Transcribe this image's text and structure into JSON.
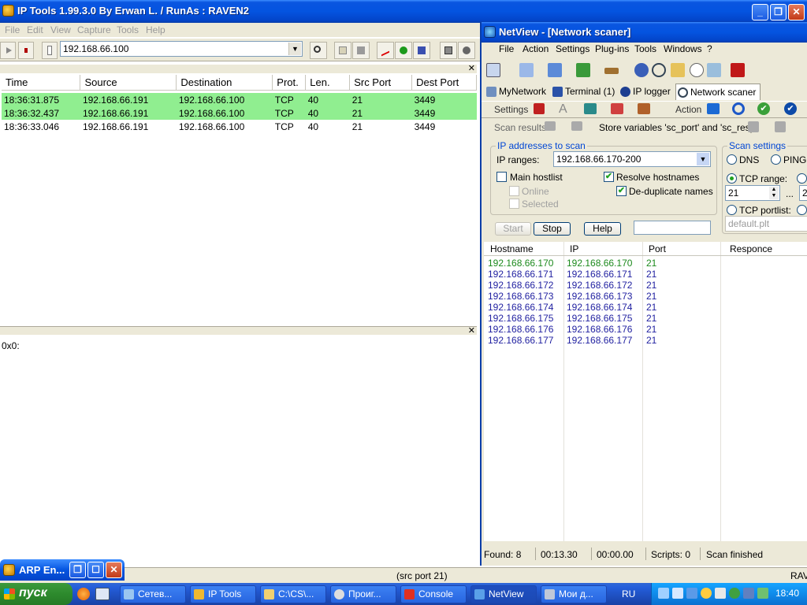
{
  "iptools": {
    "title": "IP Tools 1.99.3.0 By Erwan L. / RunAs : RAVEN2",
    "menu": [
      "File",
      "Edit",
      "View",
      "Capture",
      "Tools",
      "Help"
    ],
    "address": "192.168.66.100",
    "columns": [
      "Time",
      "Source",
      "Destination",
      "Prot.",
      "Len.",
      "Src Port",
      "Dest Port"
    ],
    "rows": [
      [
        "18:36:31.875",
        "192.168.66.191",
        "192.168.66.100",
        "TCP",
        "40",
        "21",
        "3449"
      ],
      [
        "18:36:32.437",
        "192.168.66.191",
        "192.168.66.100",
        "TCP",
        "40",
        "21",
        "3449"
      ],
      [
        "18:36:33.046",
        "192.168.66.191",
        "192.168.66.100",
        "TCP",
        "40",
        "21",
        "3449"
      ]
    ],
    "hex_text": "0x0:",
    "status_text": "(src port 21)",
    "status_right": "RAV"
  },
  "netview": {
    "title": "NetView - [Network scaner]",
    "menu": [
      "File",
      "Action",
      "Settings",
      "Plug-ins",
      "Tools",
      "Windows",
      "?"
    ],
    "tabs": [
      "MyNetwork",
      "Terminal (1)",
      "IP logger",
      "Network scaner"
    ],
    "settings_label": "Settings",
    "action_label": "Action",
    "scan_results_label": "Scan results",
    "store_vars_label": "Store variables 'sc_port' and 'sc_resp'",
    "ip_group": {
      "legend": "IP addresses to scan",
      "ip_ranges_label": "IP ranges:",
      "ip_ranges_value": "192.168.66.170-200",
      "main_hostlist": "Main hostlist",
      "online": "Online",
      "selected": "Selected",
      "resolve_hostnames": "Resolve hostnames",
      "dedup_names": "De-duplicate names"
    },
    "scan_group": {
      "legend": "Scan settings",
      "dns": "DNS",
      "ping": "PING",
      "tcp_range": "TCP range:",
      "range_from": "21",
      "range_sep": "...",
      "range_to": "2",
      "tcp_portlist": "TCP portlist:",
      "portlist_value": "default.plt"
    },
    "buttons": {
      "start": "Start",
      "stop": "Stop",
      "help": "Help"
    },
    "result_columns": [
      "Hostname",
      "IP",
      "Port",
      "Responce"
    ],
    "results": [
      [
        "192.168.66.170",
        "192.168.66.170",
        "21"
      ],
      [
        "192.168.66.171",
        "192.168.66.171",
        "21"
      ],
      [
        "192.168.66.172",
        "192.168.66.172",
        "21"
      ],
      [
        "192.168.66.173",
        "192.168.66.173",
        "21"
      ],
      [
        "192.168.66.174",
        "192.168.66.174",
        "21"
      ],
      [
        "192.168.66.175",
        "192.168.66.175",
        "21"
      ],
      [
        "192.168.66.176",
        "192.168.66.176",
        "21"
      ],
      [
        "192.168.66.177",
        "192.168.66.177",
        "21"
      ]
    ],
    "status": {
      "found": "Found: 8",
      "elapsed": "00:13.30",
      "remaining": "00:00.00",
      "scripts": "Scripts: 0",
      "state": "Scan finished"
    }
  },
  "arp_window": {
    "title": "ARP En..."
  },
  "taskbar": {
    "start": "пуск",
    "tasks": [
      "Сетев...",
      "IP Tools",
      "C:\\CS\\...",
      "Проиг...",
      "Console",
      "NetView",
      "Мои д..."
    ],
    "lang": "RU",
    "time": "18:40"
  }
}
